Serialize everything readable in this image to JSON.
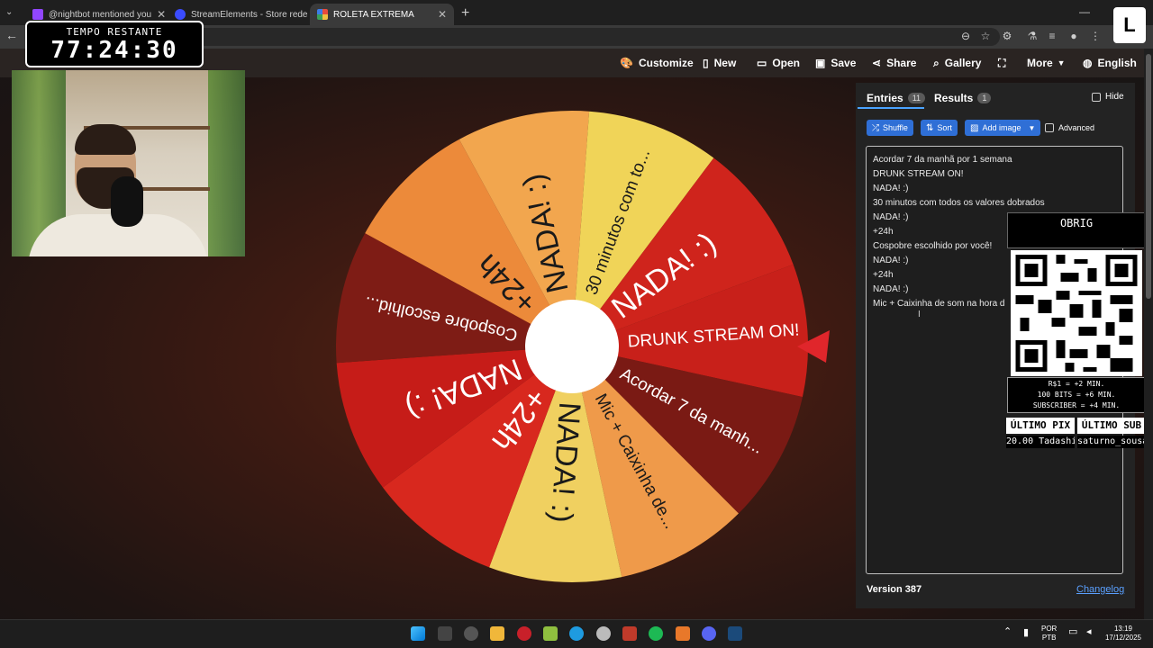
{
  "browser": {
    "tabs": [
      {
        "title": "@nightbot mentioned you",
        "favicon_color": "#9146ff"
      },
      {
        "title": "StreamElements - Store redemptio",
        "favicon_color": "#3b4cff"
      },
      {
        "title": "ROLETA EXTREMA",
        "favicon_color": "#e84b3c"
      }
    ]
  },
  "timer": {
    "label": "TEMPO RESTANTE",
    "value": "77:24:30"
  },
  "nav": {
    "customize": "Customize",
    "new": "New",
    "open": "Open",
    "save": "Save",
    "share": "Share",
    "gallery": "Gallery",
    "more": "More",
    "language": "English"
  },
  "wheel": {
    "pointer_color": "#e0262b",
    "center_color": "#ffffff",
    "segments": [
      {
        "label": "DRUNK STREAM ON!",
        "color": "#c8201a"
      },
      {
        "label": "Acordar 7 da manh...",
        "color": "#7a1a14"
      },
      {
        "label": "Mic + Caixinha de...",
        "color": "#ef9a4a"
      },
      {
        "label": "NADA! :)",
        "color": "#f0d060"
      },
      {
        "label": "+24h",
        "color": "#d8281e"
      },
      {
        "label": "NADA! :)",
        "color": "#c61c18"
      },
      {
        "label": "Cospobre escolhid...",
        "color": "#7e1c15"
      },
      {
        "label": "+24h",
        "color": "#ec8a3a"
      },
      {
        "label": "NADA! :)",
        "color": "#f2a64e"
      },
      {
        "label": "30 minutos com to...",
        "color": "#f0d458"
      },
      {
        "label": "NADA! :)",
        "color": "#cf241c"
      }
    ]
  },
  "panel": {
    "tab_entries": "Entries",
    "entries_count": "11",
    "tab_results": "Results",
    "results_count": "1",
    "hide": "Hide",
    "shuffle": "Shuffle",
    "sort": "Sort",
    "add_image": "Add image",
    "advanced": "Advanced",
    "entries": [
      "Acordar 7 da manhã por 1 semana",
      "DRUNK STREAM ON!",
      "NADA! :)",
      "30 minutos com todos os valores dobrados",
      "NADA! :)",
      "+24h",
      "Cospobre escolhido por você!",
      "NADA! :)",
      "+24h",
      "NADA! :)",
      "Mic + Caixinha de som na hora d"
    ],
    "version": "Version 387",
    "changelog": "Changelog"
  },
  "overlay": {
    "obrig": "OBRIG",
    "info": [
      "R$1 = +2 MIN.",
      "100 BITS = +6 MIN.",
      "SUBSCRIBER = +4 MIN."
    ],
    "last_pix_label": "ÚLTIMO PIX",
    "last_sub_label": "ÚLTIMO SUB",
    "last_pix_value": "20.00 Tadashi",
    "last_sub_value": "saturno_sousa"
  },
  "taskbar": {
    "lang": "POR",
    "layout": "PTB",
    "time": "13:19",
    "date": "17/12/2025"
  }
}
